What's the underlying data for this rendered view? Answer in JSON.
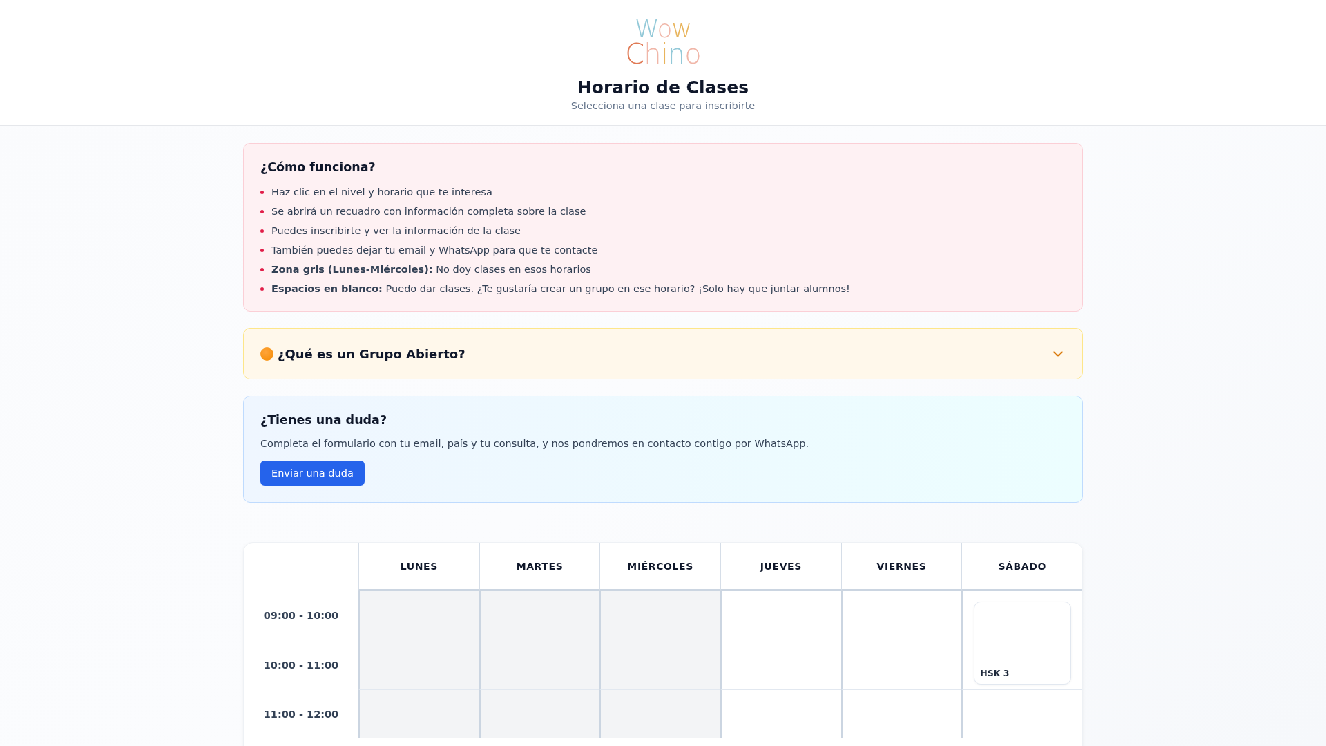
{
  "header": {
    "logo": {
      "line_1": "Wow",
      "line_2": "Chino"
    },
    "title": "Horario de Clases",
    "subtitle": "Selecciona una clase para inscribirte"
  },
  "how_it_works": {
    "title": "¿Cómo funciona?",
    "items": [
      "Haz clic en el nivel y horario que te interesa",
      "Se abrirá un recuadro con información completa sobre la clase",
      "Puedes inscribirte y ver la información de la clase",
      "También puedes dejar tu email y WhatsApp para que te contacte",
      "**Zona gris (Lunes-Miércoles):** No doy clases en esos horarios",
      "**Espacios en blanco:** Puedo dar clases. ¿Te gustaría crear un grupo en ese horario? ¡Solo hay que juntar alumnos!"
    ]
  },
  "open_group": {
    "title": "¿Qué es un Grupo Abierto?",
    "expanded": false
  },
  "question": {
    "title": "¿Tienes una duda?",
    "text": "Completa el formulario con tu email, país y tu consulta, y nos pondremos en contacto contigo por WhatsApp.",
    "button": "Enviar una duda"
  },
  "schedule": {
    "days": [
      "LUNES",
      "MARTES",
      "MIÉRCOLES",
      "JUEVES",
      "VIERNES",
      "SÁBADO"
    ],
    "rows": [
      {
        "time": "09:00 - 10:00",
        "cells": [
          {
            "kind": "unavailable"
          },
          {
            "kind": "unavailable"
          },
          {
            "kind": "unavailable"
          },
          {
            "kind": "open"
          },
          {
            "kind": "open"
          },
          {
            "kind": "class",
            "label": "HSK 3"
          }
        ]
      },
      {
        "time": "10:00 - 11:00",
        "cells": [
          {
            "kind": "unavailable"
          },
          {
            "kind": "unavailable"
          },
          {
            "kind": "unavailable"
          },
          {
            "kind": "open"
          },
          {
            "kind": "open"
          },
          {
            "kind": "continued"
          }
        ]
      },
      {
        "time": "11:00 - 12:00",
        "cells": [
          {
            "kind": "unavailable"
          },
          {
            "kind": "unavailable"
          },
          {
            "kind": "unavailable"
          },
          {
            "kind": "open"
          },
          {
            "kind": "open"
          },
          {
            "kind": "open"
          }
        ]
      }
    ]
  }
}
